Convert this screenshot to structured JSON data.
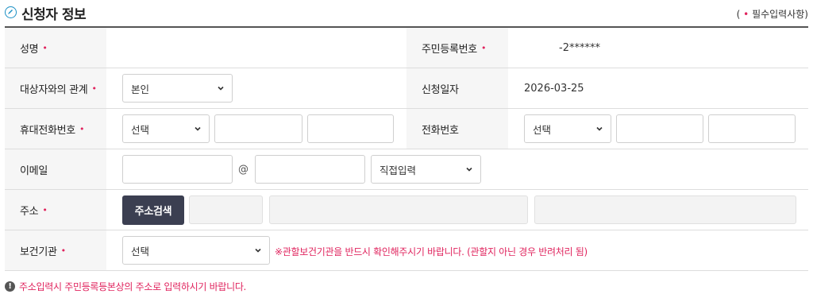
{
  "header": {
    "title": "신청자 정보",
    "required_note_prefix": "(",
    "required_note_star": "•",
    "required_note_text": "필수입력사항)"
  },
  "rows": {
    "name": {
      "label": "성명",
      "required": "•",
      "value": ""
    },
    "rrn": {
      "label": "주민등록번호",
      "required": "•",
      "value": "-2******"
    },
    "relation": {
      "label": "대상자와의 관계",
      "required": "•",
      "selected": "본인"
    },
    "apply_date": {
      "label": "신청일자",
      "value": "2026-03-25"
    },
    "mobile": {
      "label": "휴대전화번호",
      "required": "•",
      "selected": "선택",
      "part2": "",
      "part3": ""
    },
    "phone": {
      "label": "전화번호",
      "selected": "선택",
      "part2": "",
      "part3": ""
    },
    "email": {
      "label": "이메일",
      "local": "",
      "at": "@",
      "domain": "",
      "domain_select": "직접입력"
    },
    "address": {
      "label": "주소",
      "required": "•",
      "search_button": "주소검색",
      "zip": "",
      "addr1": "",
      "addr2": ""
    },
    "health_center": {
      "label": "보건기관",
      "required": "•",
      "selected": "선택",
      "notice": "※관할보건기관을 반드시 확인해주시기 바랍니다. (관할지 아닌 경우 반려처리 됨)"
    }
  },
  "footer": {
    "icon": "!",
    "note": "주소입력시 주민등록등본상의 주소로 입력하시기 바랍니다."
  },
  "colors": {
    "required": "#e0245e",
    "button": "#3b3f51",
    "label_bg": "#f6f6f6"
  }
}
